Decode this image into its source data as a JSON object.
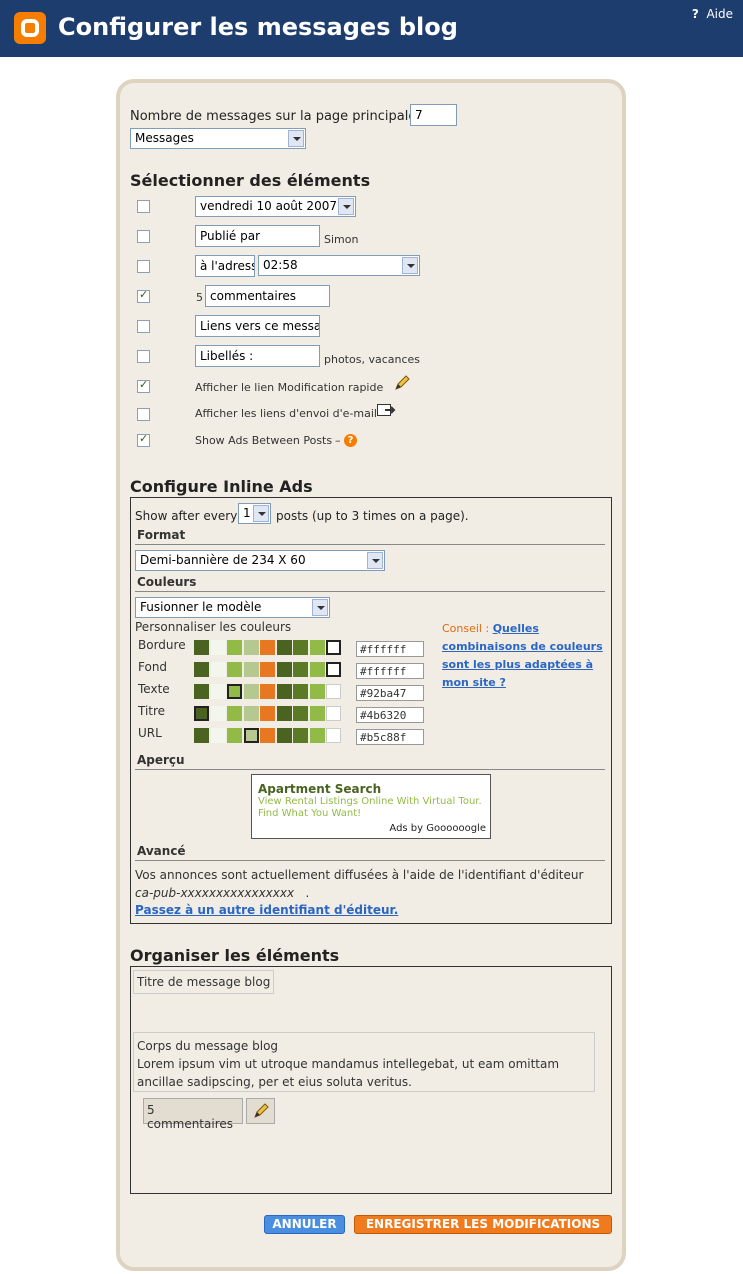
{
  "header": {
    "title": "Configurer les messages blog",
    "help_label": "Aide",
    "help_icon": "?"
  },
  "posts_count": {
    "label": "Nombre de messages sur la page principale :",
    "value": "7",
    "unit_select": "Messages"
  },
  "select_elements": {
    "heading": "Sélectionner des éléments",
    "date": {
      "checked": false,
      "value": "vendredi 10 août 2007"
    },
    "posted_by": {
      "checked": false,
      "value": "Publié par",
      "suffix": "Simon"
    },
    "time": {
      "checked": false,
      "prefix_value": "à l'adress",
      "value": "02:58"
    },
    "comments": {
      "checked": true,
      "prefix": "5",
      "value": "commentaires"
    },
    "links": {
      "checked": false,
      "value": "Liens vers ce messa"
    },
    "labels": {
      "checked": false,
      "value": "Libellés :",
      "suffix": "photos, vacances"
    },
    "quick_edit": {
      "checked": true,
      "label": "Afficher le lien Modification rapide"
    },
    "email_links": {
      "checked": false,
      "label": "Afficher les liens d'envoi d'e-mail"
    },
    "ads": {
      "checked": true,
      "label": "Show Ads Between Posts",
      "dash": "–"
    }
  },
  "inline_ads": {
    "heading": "Configure Inline Ads",
    "show_after_label": "Show after every",
    "show_after_value": "1",
    "show_after_suffix": "posts (up to 3 times on a page).",
    "format_heading": "Format",
    "format_value": "Demi-bannière de 234 X 60",
    "colors_heading": "Couleurs",
    "colors_value": "Fusionner le modèle",
    "customize_label": "Personnaliser les couleurs",
    "tip_prefix": "Conseil :",
    "tip_link": "Quelles combinaisons de couleurs sont les plus adaptées à mon site ?",
    "palette": [
      "#4b6320",
      "#f2f6ec",
      "#92ba47",
      "#b5c88f",
      "#e87722",
      "#4b6320",
      "#5a7a25",
      "#92ba47",
      "#ffffff"
    ],
    "color_rows": [
      {
        "label": "Bordure",
        "hex": "#ffffff",
        "selected": 8
      },
      {
        "label": "Fond",
        "hex": "#ffffff",
        "selected": 8
      },
      {
        "label": "Texte",
        "hex": "#92ba47",
        "selected": 2
      },
      {
        "label": "Titre",
        "hex": "#4b6320",
        "selected": 0
      },
      {
        "label": "URL",
        "hex": "#b5c88f",
        "selected": 3
      }
    ],
    "preview_heading": "Aperçu",
    "preview": {
      "title": "Apartment Search",
      "body": "View Rental Listings Online With Virtual Tour. Find What You Want!",
      "by": "Ads by Goooooogle"
    },
    "advanced_heading": "Avancé",
    "advanced_text": "Vos annonces sont actuellement diffusées à l'aide de l'identifiant d'éditeur",
    "publisher_id": "ca-pub-xxxxxxxxxxxxxxxx",
    "publisher_id_end": ".",
    "switch_link": "Passez à un autre identifiant d'éditeur."
  },
  "organize": {
    "heading": "Organiser les éléments",
    "post_title": "Titre de message blog",
    "body_title": "Corps du message blog",
    "body_text": "Lorem ipsum vim ut utroque mandamus intellegebat, ut eam omittam ancillae sadipscing, per et eius soluta veritus.",
    "comments": "5 commentaires"
  },
  "buttons": {
    "cancel": "ANNULER",
    "save": "ENREGISTRER LES MODIFICATIONS"
  },
  "colors": {
    "header_bg": "#1d3d6e",
    "panel_bg": "#f1ede4",
    "accent_orange": "#f57d00",
    "link": "#2b66c4"
  }
}
